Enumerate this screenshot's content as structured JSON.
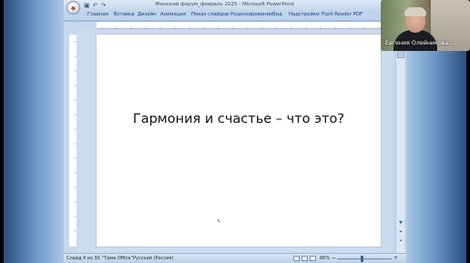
{
  "window": {
    "title": "Женский форум_февраль 2025 - Microsoft PowerPoint",
    "office_button_icon": "office-logo-icon",
    "qat": [
      "save-icon",
      "undo-icon",
      "redo-icon"
    ]
  },
  "ribbon": {
    "tabs": [
      "Главная",
      "Вставка",
      "Дизайн",
      "Анимация",
      "Показ слайдов",
      "Рецензирование",
      "Вид",
      "Надстройки",
      "Foxit Reader PDF"
    ]
  },
  "slide": {
    "title": "Гармония и счастье – что это?"
  },
  "statusbar": {
    "slide_counter": "Слайд 4 из 30",
    "theme": "\"Тема Office\"",
    "language": "Русский (Россия)",
    "zoom": "86%",
    "zoom_minus": "−",
    "zoom_plus": "+"
  },
  "webcam": {
    "participant_name": "Евгения Олейникова,..."
  },
  "colors": {
    "ribbon_tab_text": "#15428b",
    "window_frame": "#c5d8ee",
    "slide_bg": "#ffffff"
  }
}
